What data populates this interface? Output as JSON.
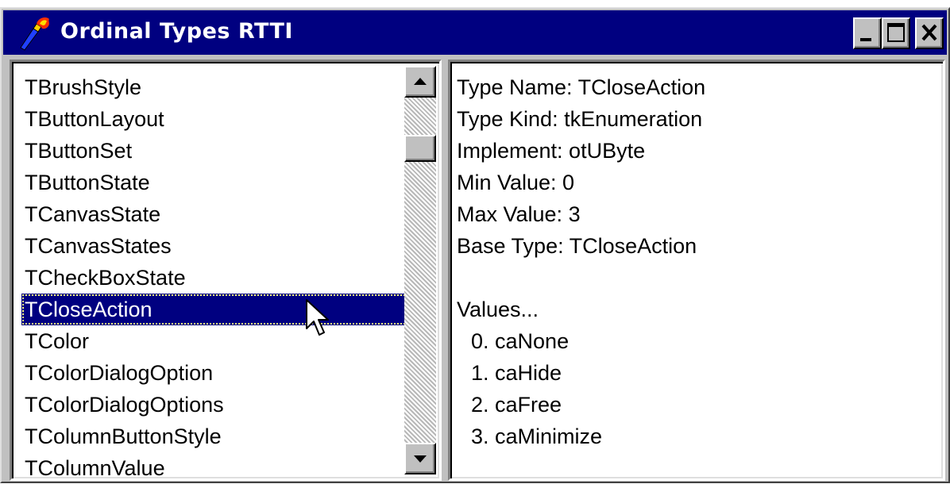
{
  "window": {
    "title": "Ordinal Types RTTI",
    "controls": {
      "minimize": "minimize",
      "maximize": "maximize",
      "close": "close"
    }
  },
  "type_list": {
    "items": [
      "TBrushStyle",
      "TButtonLayout",
      "TButtonSet",
      "TButtonState",
      "TCanvasState",
      "TCanvasStates",
      "TCheckBoxState",
      "TCloseAction",
      "TColor",
      "TColorDialogOption",
      "TColorDialogOptions",
      "TColumnButtonStyle",
      "TColumnValue"
    ],
    "selected": "TCloseAction"
  },
  "details": {
    "type_name": "Type Name: TCloseAction",
    "type_kind": "Type Kind: tkEnumeration",
    "implement": "Implement: otUByte",
    "min_value": "Min Value: 0",
    "max_value": "Max Value: 3",
    "base_type": "Base Type: TCloseAction",
    "values_header": "Values...",
    "values": [
      "0. caNone",
      "1. caHide",
      "2. caFree",
      "3. caMinimize"
    ]
  },
  "colors": {
    "title_bar": "#000080",
    "selection": "#000080",
    "face": "#c0c0c0"
  },
  "icons": [
    "torch-icon",
    "minimize-icon",
    "maximize-icon",
    "close-icon",
    "scroll-up-icon",
    "scroll-down-icon",
    "mouse-pointer-icon"
  ]
}
